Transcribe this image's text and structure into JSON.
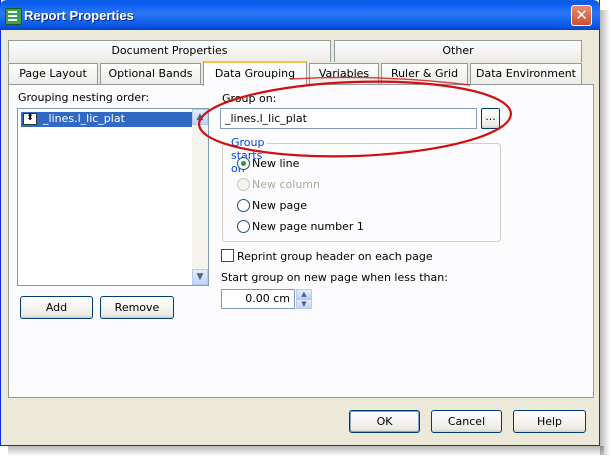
{
  "window": {
    "title": "Report Properties",
    "close_glyph": "✕",
    "icon": "report-app-icon"
  },
  "tabs": {
    "row1": [
      {
        "label": "Document Properties"
      },
      {
        "label": "Other"
      }
    ],
    "row2": [
      {
        "label": "Page Layout"
      },
      {
        "label": "Optional Bands"
      },
      {
        "label": "Data Grouping"
      },
      {
        "label": "Variables"
      },
      {
        "label": "Ruler & Grid"
      },
      {
        "label": "Data Environment"
      }
    ],
    "active": "Data Grouping"
  },
  "grouping": {
    "nesting_label": "Grouping nesting order:",
    "items": [
      {
        "label": "_lines.l_lic_plat",
        "icon": "move-updown-icon"
      }
    ],
    "add_label": "Add",
    "remove_label": "Remove",
    "scroll_up": "▲",
    "scroll_down": "▼",
    "move_glyph": "⬍"
  },
  "group_on": {
    "label": "Group on:",
    "value": "_lines.l_lic_plat",
    "browse_label": "..."
  },
  "group_starts_on": {
    "legend": "Group starts on",
    "options": [
      {
        "label": "New line",
        "checked": true,
        "enabled": true
      },
      {
        "label": "New column",
        "checked": false,
        "enabled": false
      },
      {
        "label": "New page",
        "checked": false,
        "enabled": true
      },
      {
        "label": "New page number 1",
        "checked": false,
        "enabled": true
      }
    ]
  },
  "reprint": {
    "label": "Reprint group header on each page",
    "checked": false
  },
  "start_group": {
    "label": "Start group on new page when less than:",
    "value": "0.00 cm"
  },
  "footer": {
    "ok_label": "OK",
    "cancel_label": "Cancel",
    "help_label": "Help"
  },
  "colors": {
    "accent": "#316ac5",
    "annotation": "#d01010",
    "title_bar": "#0a5ae6"
  }
}
